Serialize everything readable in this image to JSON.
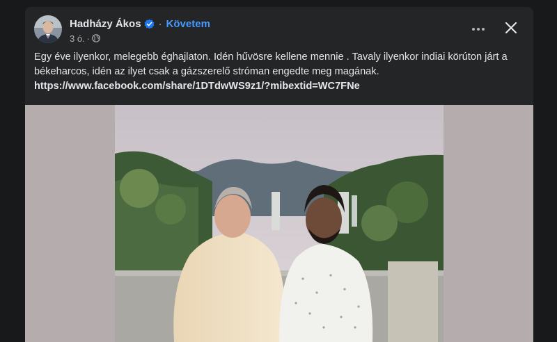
{
  "post": {
    "author": "Hadházy Ákos",
    "separator": "·",
    "follow_label": "Követem",
    "time": "3 ó.",
    "privacy_icon": "globe-icon",
    "text": "Egy éve ilyenkor, melegebb éghajlaton. Idén hűvösre kellene mennie . Tavaly ilyenkor indiai körúton járt a békeharcos, idén az ilyet csak a gázszerelő stróman engedte meg magának.",
    "link": "https://www.facebook.com/share/1DTdwWS9z1/?mibextid=WC7FNe"
  },
  "icons": {
    "verified": "verified-badge-icon",
    "more": "more-options-icon",
    "close": "close-icon"
  },
  "colors": {
    "background": "#18191a",
    "card": "#242526",
    "text": "#e4e6eb",
    "secondary_text": "#b0b3b8",
    "accent": "#4599ff",
    "verified": "#1877f2"
  }
}
